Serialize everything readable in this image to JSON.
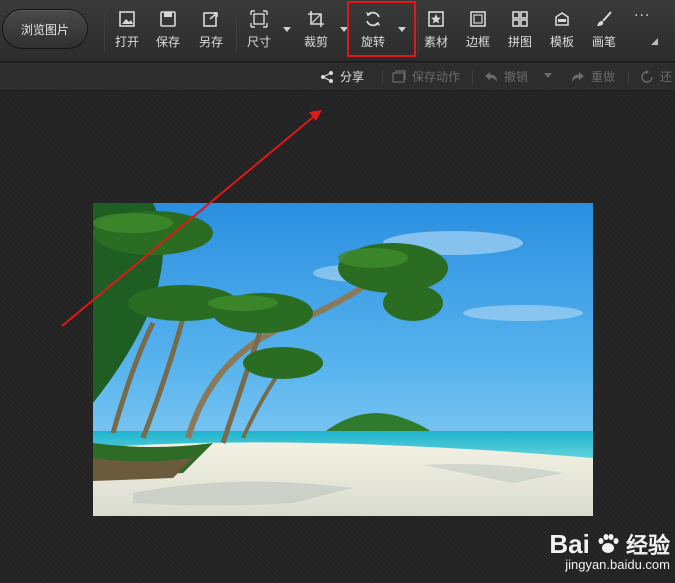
{
  "toolbar": {
    "browse_label": "浏览图片",
    "tools": [
      {
        "label": "打开",
        "icon": "open-image-icon"
      },
      {
        "label": "保存",
        "icon": "save-icon"
      },
      {
        "label": "另存",
        "icon": "save-as-icon"
      },
      {
        "label": "尺寸",
        "icon": "resize-icon"
      },
      {
        "label": "裁剪",
        "icon": "crop-icon"
      },
      {
        "label": "旋转",
        "icon": "rotate-icon"
      },
      {
        "label": "素材",
        "icon": "material-icon"
      },
      {
        "label": "边框",
        "icon": "border-icon"
      },
      {
        "label": "拼图",
        "icon": "collage-icon"
      },
      {
        "label": "模板",
        "icon": "template-icon"
      },
      {
        "label": "画笔",
        "icon": "brush-icon"
      }
    ],
    "more_label": "···",
    "highlight_color": "#e01818"
  },
  "subbar": {
    "share": "分享",
    "save_action": "保存动作",
    "undo": "撤销",
    "redo": "重做",
    "restore": "还"
  },
  "canvas": {
    "image_alt": "tropical beach with palm trees",
    "annotation_color": "#e01818"
  },
  "watermark": {
    "brand": "Bai",
    "suffix": "经验",
    "url": "jingyan.baidu.com"
  }
}
